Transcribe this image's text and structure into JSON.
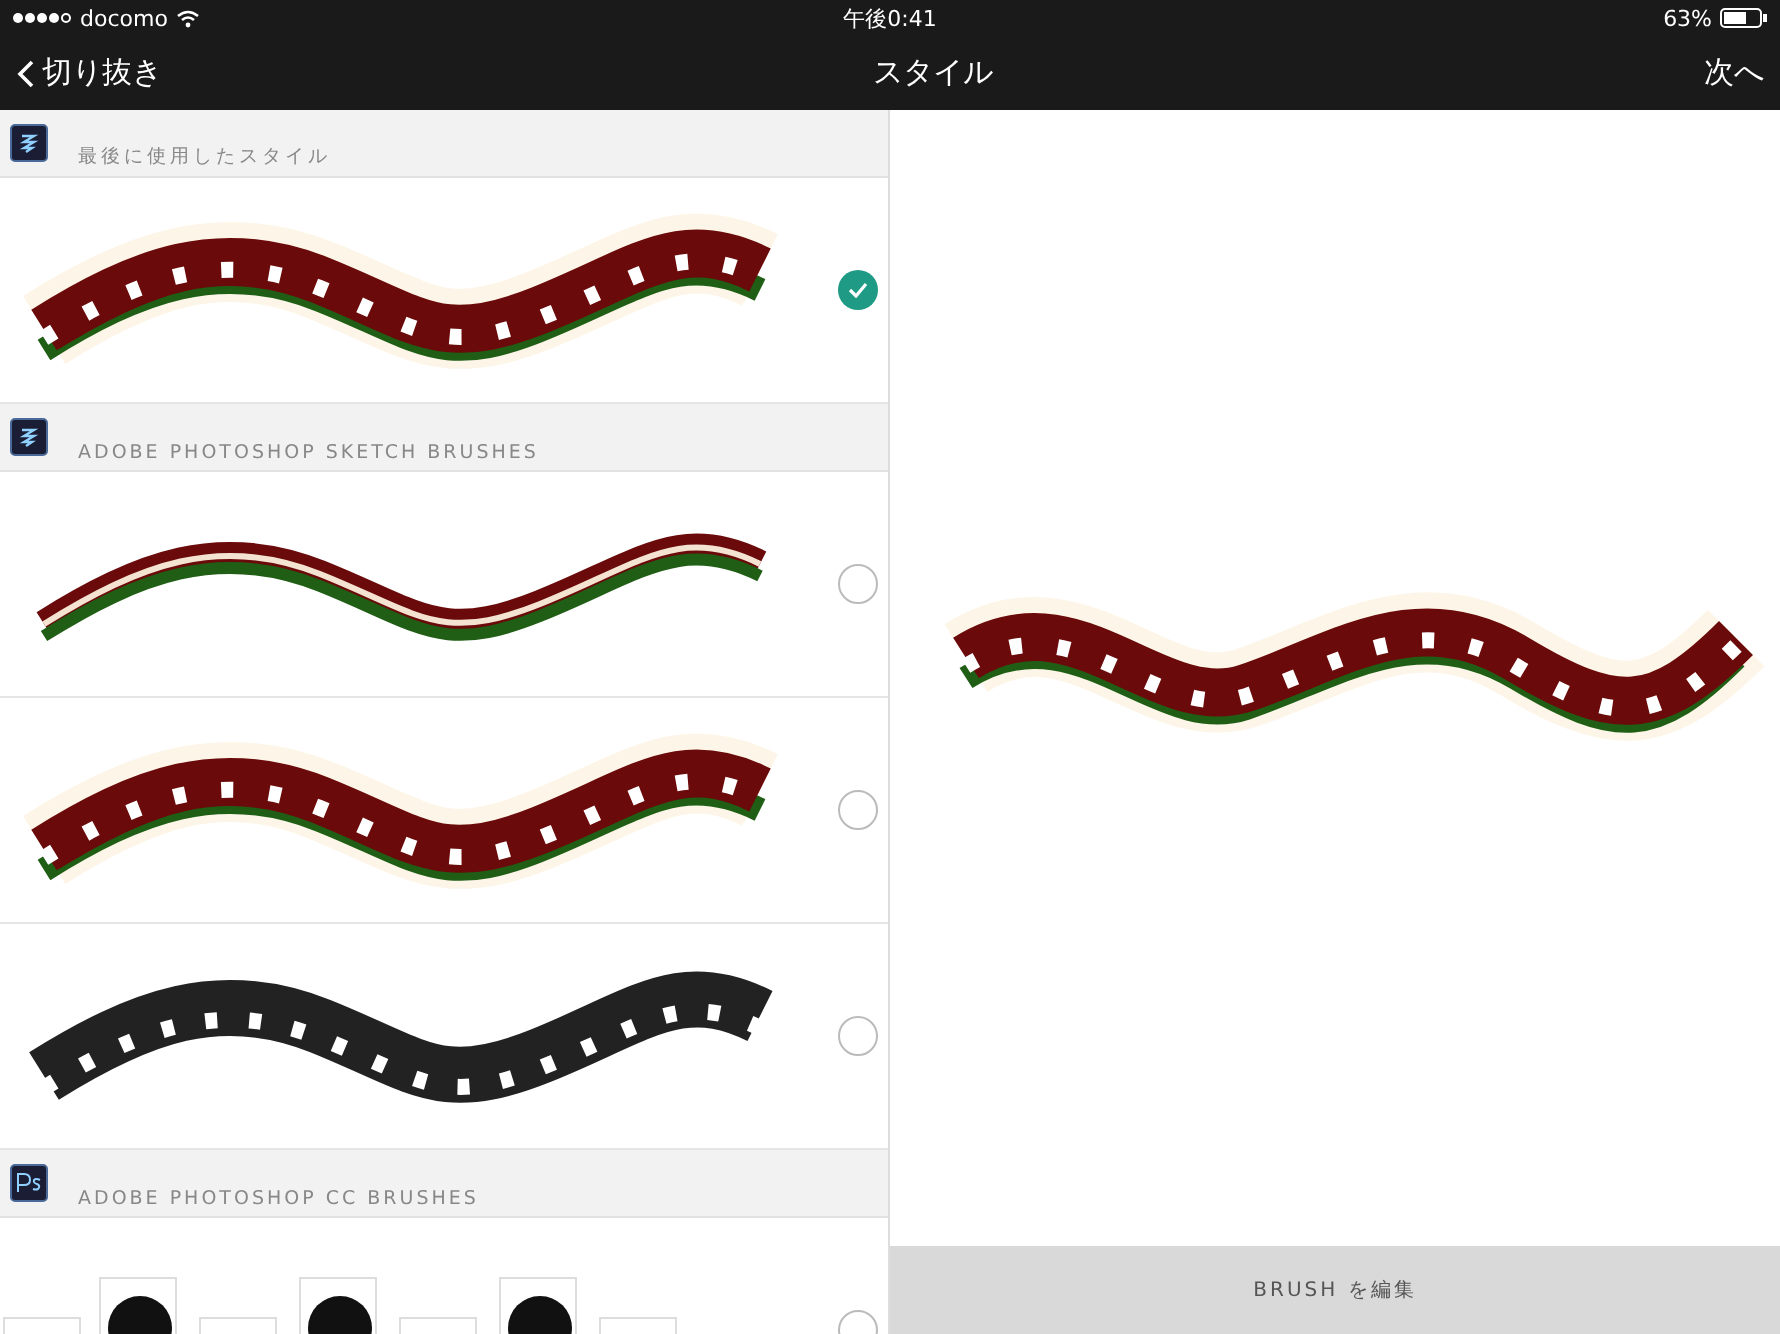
{
  "status_bar": {
    "carrier": "docomo",
    "time": "午後0:41",
    "battery": "63%"
  },
  "nav_bar": {
    "back": "切り抜き",
    "title": "スタイル",
    "next": "次へ"
  },
  "sections": [
    {
      "kind": "sketch",
      "title": "最後に使用したスタイル",
      "styles": [
        {
          "kind": "ornate",
          "selected": true
        }
      ]
    },
    {
      "kind": "sketch",
      "title": "ADOBE PHOTOSHOP SKETCH BRUSHES",
      "styles": [
        {
          "kind": "ribbon",
          "selected": false
        },
        {
          "kind": "ornate",
          "selected": false
        },
        {
          "kind": "mono",
          "selected": false
        }
      ]
    },
    {
      "kind": "ps",
      "title": "ADOBE PHOTOSHOP CC BRUSHES",
      "styles": [
        {
          "kind": "stamps",
          "selected": false
        }
      ]
    }
  ],
  "preview": {
    "kind": "ornate"
  },
  "edit_button": "BRUSH を編集"
}
